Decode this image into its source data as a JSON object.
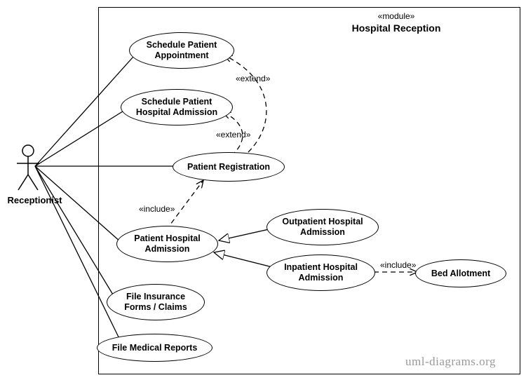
{
  "diagram": {
    "module_stereotype": "«module»",
    "module_name": "Hospital Reception",
    "actor": {
      "name": "Receptionist"
    },
    "usecases": {
      "schedule_appointment": "Schedule Patient\nAppointment",
      "schedule_admission": "Schedule Patient\nHospital Admission",
      "patient_registration": "Patient Registration",
      "patient_hospital_admission": "Patient Hospital\nAdmission",
      "outpatient_admission": "Outpatient Hospital\nAdmission",
      "inpatient_admission": "Inpatient Hospital\nAdmission",
      "bed_allotment": "Bed Allotment",
      "file_insurance": "File Insurance\nForms / Claims",
      "file_medical": "File Medical Reports"
    },
    "relationships": {
      "extend1": "«extend»",
      "extend2": "«extend»",
      "include1": "«include»",
      "include2": "«include»"
    },
    "watermark": "uml-diagrams.org"
  }
}
